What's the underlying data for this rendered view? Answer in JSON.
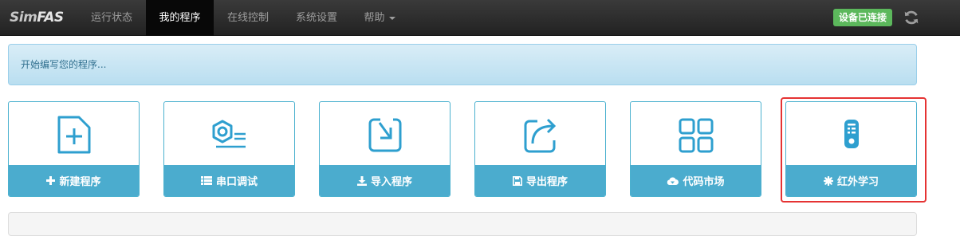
{
  "brand": {
    "part1": "Sim",
    "part2": "FAS"
  },
  "nav": {
    "items": [
      {
        "label": "运行状态",
        "active": false
      },
      {
        "label": "我的程序",
        "active": true
      },
      {
        "label": "在线控制",
        "active": false
      },
      {
        "label": "系统设置",
        "active": false
      },
      {
        "label": "帮助",
        "active": false,
        "dropdown": true
      }
    ],
    "status_badge": "设备已连接",
    "status_color": "#5cb85c",
    "refresh_icon": "refresh-icon"
  },
  "alert": {
    "text": "开始编写您的程序..."
  },
  "tiles": [
    {
      "label": "新建程序",
      "icon": "new-file-icon",
      "footer_icon": "plus-icon"
    },
    {
      "label": "串口调试",
      "icon": "serial-port-icon",
      "footer_icon": "list-icon"
    },
    {
      "label": "导入程序",
      "icon": "import-icon",
      "footer_icon": "download-icon"
    },
    {
      "label": "导出程序",
      "icon": "export-icon",
      "footer_icon": "save-icon"
    },
    {
      "label": "代码市场",
      "icon": "grid-icon",
      "footer_icon": "cloud-download-icon"
    },
    {
      "label": "红外学习",
      "icon": "remote-control-icon",
      "footer_icon": "asterisk-icon",
      "highlighted": true
    }
  ],
  "colors": {
    "accent": "#4bacce",
    "tile_border": "#4bb1cf",
    "highlight": "#e53333",
    "navbar": "#222222"
  }
}
